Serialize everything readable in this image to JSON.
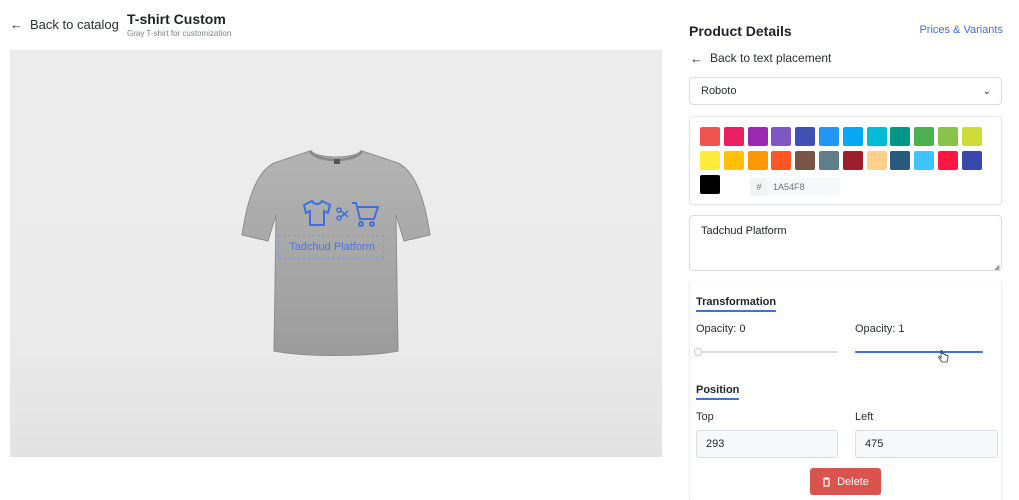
{
  "header": {
    "back_label": "Back to catalog",
    "title": "T-shirt Custom",
    "subtitle": "Gray T-shirt for customization"
  },
  "canvas": {
    "design_text": "Tadchud Platform",
    "shirt_color": "#a5a5a5"
  },
  "panel": {
    "title": "Product Details",
    "prices_link": "Prices & Variants",
    "back_label": "Back to text placement",
    "font_select": "Roboto",
    "colors": [
      "#ef5350",
      "#e91e63",
      "#9c27b0",
      "#7e57c2",
      "#3f51b5",
      "#2196f3",
      "#03a9f4",
      "#00bcd4",
      "#009688",
      "#4caf50",
      "#8bc34a",
      "#cddc39",
      "#ffeb3b",
      "#ffc107",
      "#ff9800",
      "#ff5722",
      "#795548",
      "#607d8b",
      "#9e1f2b",
      "#ffd08a",
      "#2a5a80",
      "#40c4ff",
      "#ff1744",
      "#3949ab",
      "#000000"
    ],
    "hex_symbol": "#",
    "hex_value": "1A54F8",
    "text_value": "Tadchud Platform",
    "transformation_label": "Transformation",
    "opacity_left_label": "Opacity: 0",
    "opacity_right_label": "Opacity: 1",
    "opacity_left_value": 0,
    "opacity_right_value": 1,
    "position_label": "Position",
    "top_label": "Top",
    "top_value": "293",
    "left_label": "Left",
    "left_value": "475",
    "unit": "%",
    "delete_label": "Delete",
    "accent_color": "#3f6fe0",
    "delete_color": "#d9534f"
  }
}
